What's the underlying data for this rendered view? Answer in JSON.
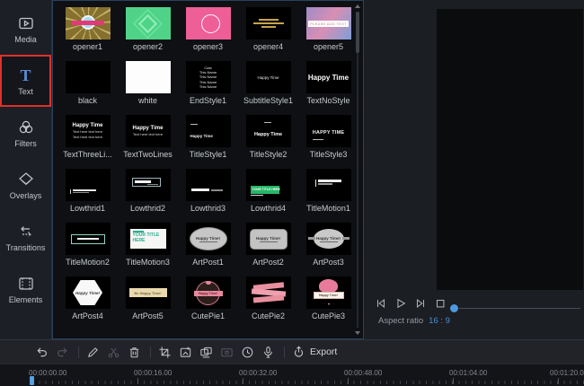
{
  "colors": {
    "selection_red": "#e0302a",
    "accent_blue": "#4a8fd6",
    "text_tab_blue": "#5b8dd6",
    "playhead_blue": "#57a1e4",
    "panel_border_blue": "#28425e"
  },
  "sidebar": {
    "items": [
      {
        "label": "Media",
        "icon": "media-icon",
        "selected": false
      },
      {
        "label": "Text",
        "icon": "text-icon",
        "selected": true
      },
      {
        "label": "Filters",
        "icon": "filters-icon",
        "selected": false
      },
      {
        "label": "Overlays",
        "icon": "overlays-icon",
        "selected": false
      },
      {
        "label": "Transitions",
        "icon": "transitions-icon",
        "selected": false
      },
      {
        "label": "Elements",
        "icon": "elements-icon",
        "selected": false
      }
    ]
  },
  "templates": {
    "items": [
      {
        "label": "opener1"
      },
      {
        "label": "opener2"
      },
      {
        "label": "opener3"
      },
      {
        "label": "opener4"
      },
      {
        "label": "opener5",
        "thumb_text": "PLEASE ADD TEXT"
      },
      {
        "label": "black"
      },
      {
        "label": "white"
      },
      {
        "label": "EndStyle1",
        "lines": [
          "Cast",
          "This Name",
          "This Name",
          "This Name",
          "This Name"
        ]
      },
      {
        "label": "SubtitleStyle1",
        "thumb_text": "Happy Time"
      },
      {
        "label": "TextNoStyle",
        "thumb_text": "Happy Time"
      },
      {
        "label": "TextThreeLi...",
        "lines": [
          "Happy Time",
          "Text here text here",
          "Text here text here"
        ]
      },
      {
        "label": "TextTwoLines",
        "lines": [
          "Happy Time",
          "Text here text here"
        ]
      },
      {
        "label": "TitleStyle1",
        "thumb_text": "Happy Time"
      },
      {
        "label": "TitleStyle2",
        "thumb_text": "Happy Time"
      },
      {
        "label": "TitleStyle3",
        "thumb_text": "HAPPY TIME"
      },
      {
        "label": "Lowthrid1"
      },
      {
        "label": "Lowthrid2"
      },
      {
        "label": "Lowthrid3"
      },
      {
        "label": "Lowthrid4",
        "thumb_text": "YOUR TITLE HERE"
      },
      {
        "label": "TitleMotion1"
      },
      {
        "label": "TitleMotion2"
      },
      {
        "label": "TitleMotion3",
        "thumb_text": "YOUR TITLE HERE"
      },
      {
        "label": "ArtPost1",
        "thumb_text": "Happy Time!"
      },
      {
        "label": "ArtPost2",
        "thumb_text": "Happy Time!"
      },
      {
        "label": "ArtPost3",
        "thumb_text": "Happy Time!"
      },
      {
        "label": "ArtPost4",
        "thumb_text": "Happy Time!"
      },
      {
        "label": "ArtPost5",
        "thumb_text": "Be Happy Time!"
      },
      {
        "label": "CutePie1",
        "thumb_text": "Happy Time!"
      },
      {
        "label": "CutePie2"
      },
      {
        "label": "CutePie3",
        "thumb_text": "Happy Time!"
      }
    ]
  },
  "preview": {
    "aspect_label": "Aspect ratio",
    "aspect_value": "16 : 9",
    "playback_icons": [
      "previous-frame-icon",
      "play-icon",
      "next-frame-icon",
      "stop-icon"
    ]
  },
  "toolbar": {
    "export_label": "Export",
    "icons": [
      "undo-icon",
      "redo-icon",
      "edit-pencil-icon",
      "split-scissors-icon",
      "delete-trash-icon",
      "crop-icon",
      "zoom-frame-icon",
      "freeze-frame-icon",
      "mosaic-icon",
      "duration-clock-icon",
      "voiceover-mic-icon",
      "export-icon"
    ]
  },
  "timeline": {
    "labels": [
      "00:00:00.00",
      "00:00:16.00",
      "00:00:32.00",
      "00:00:48.00",
      "00:01:04.00",
      "00:01:20.00"
    ]
  }
}
